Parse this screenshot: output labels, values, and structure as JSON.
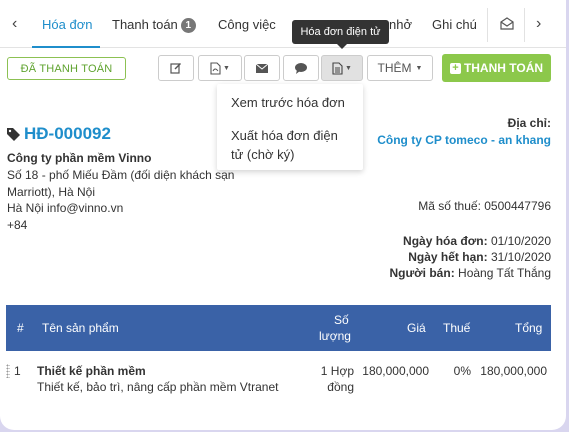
{
  "tabs": {
    "items": [
      {
        "label": "Hóa đơn"
      },
      {
        "label": "Thanh toán",
        "badge": "1"
      },
      {
        "label": "Công việc"
      },
      {
        "label": "nhở"
      },
      {
        "label": "Ghi chú"
      }
    ],
    "active_index": 0
  },
  "tooltip": {
    "text": "Hóa đơn điện tử"
  },
  "toolbar": {
    "paid_label": "ĐÃ THANH TOÁN",
    "more_label": "THÊM",
    "pay_label": "THANH TOÁN"
  },
  "dropdown": {
    "items": [
      "Xem trước hóa đơn",
      "Xuất hóa đơn điện",
      "tử (chờ ký)"
    ]
  },
  "invoice": {
    "number": "HĐ-000092",
    "company": "Công ty phần mềm Vinno",
    "address_lines": [
      "Số 18 - phố Miếu Đầm (đối diện khách sạn",
      "Marriott), Hà Nội",
      "Hà Nội info@vinno.vn",
      "+84"
    ],
    "address_label": "Địa chỉ:",
    "customer": "Công ty CP tomeco - an khang",
    "tax_code_label": "Mã số thuế:",
    "tax_code": "0500447796",
    "invoice_date_label": "Ngày hóa đơn:",
    "invoice_date": "01/10/2020",
    "due_date_label": "Ngày hết hạn:",
    "due_date": "31/10/2020",
    "seller_label": "Người bán:",
    "seller": "Hoàng Tất Thắng"
  },
  "table": {
    "headers": {
      "num": "#",
      "product": "Tên sản phẩm",
      "qty1": "Số",
      "qty2": "lượng",
      "price": "Giá",
      "tax": "Thuế",
      "total": "Tổng"
    },
    "rows": [
      {
        "num": "1",
        "name": "Thiết kế phần mềm",
        "desc": "Thiết kế, bảo trì, nâng cấp phần mềm Vtranet",
        "qty": "1 Hợp",
        "unit": "đồng",
        "price": "180,000,000",
        "tax": "0%",
        "total": "180,000,000"
      }
    ]
  },
  "colors": {
    "accent": "#1f8ecb",
    "header_bg": "#3a62a7",
    "success": "#8cc84b"
  }
}
